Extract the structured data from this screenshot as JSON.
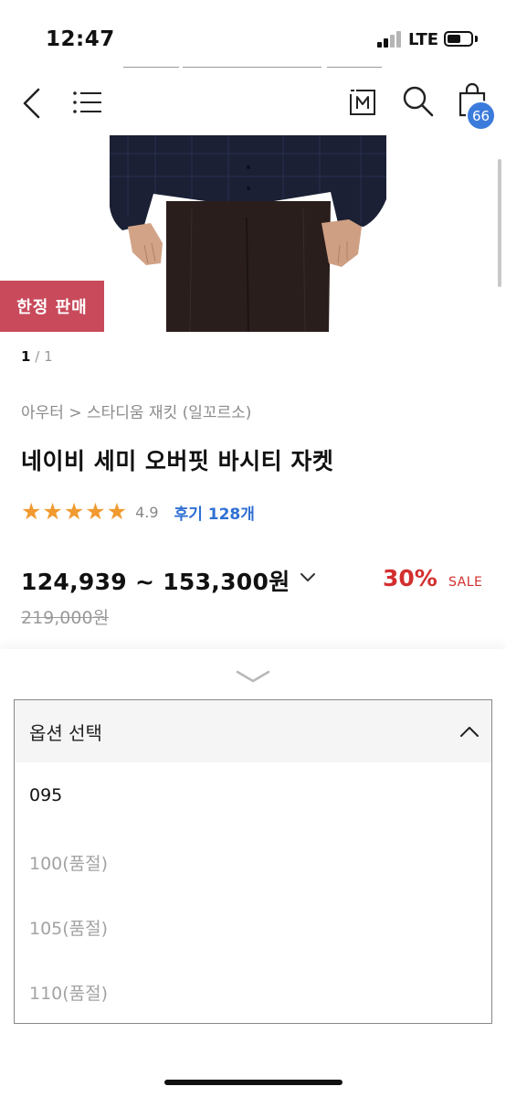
{
  "status_bar": {
    "time": "12:47",
    "network": "LTE"
  },
  "header": {
    "cart_count": "66"
  },
  "product": {
    "badge": "한정 판매",
    "pager": {
      "current": "1",
      "separator": "/",
      "total": "1"
    },
    "breadcrumb": "아우터 > 스타디움 재킷 (일꼬르소)",
    "title": "네이비 세미 오버핏 바시티 자켓",
    "rating": {
      "stars": 5,
      "value": "4.9",
      "reviews_label": "후기 128개"
    },
    "price": {
      "range": "124,939 ~ 153,300원",
      "discount": "30%",
      "sale_label": "SALE",
      "original": "219,000원"
    }
  },
  "options": {
    "header_label": "옵션 선택",
    "items": [
      {
        "label": "095",
        "available": true
      },
      {
        "label": "100(품절)",
        "available": false
      },
      {
        "label": "105(품절)",
        "available": false
      },
      {
        "label": "110(품절)",
        "available": false
      }
    ]
  },
  "colors": {
    "accent_blue": "#2f6fd4",
    "badge_red": "#c84a5b",
    "sale_red": "#d32f2f",
    "star_orange": "#f19a30"
  }
}
